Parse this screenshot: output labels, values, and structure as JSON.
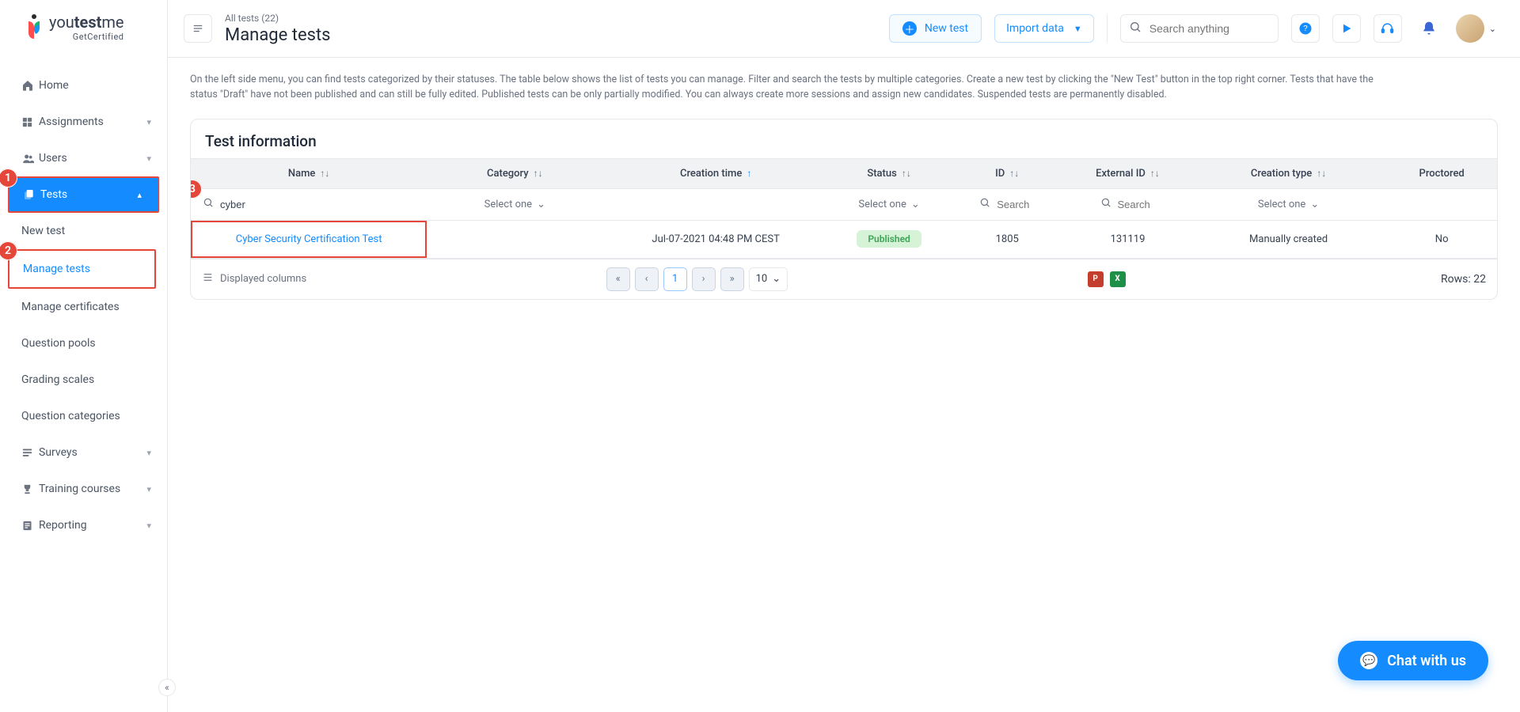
{
  "brand": {
    "you": "you",
    "test": "test",
    "me": "me",
    "sub": "GetCertified"
  },
  "sidebar": {
    "items": [
      {
        "label": "Home"
      },
      {
        "label": "Assignments"
      },
      {
        "label": "Users"
      },
      {
        "label": "Tests"
      },
      {
        "label": "Surveys"
      },
      {
        "label": "Training courses"
      },
      {
        "label": "Reporting"
      }
    ],
    "tests_sub": [
      {
        "label": "New test"
      },
      {
        "label": "Manage tests"
      },
      {
        "label": "Manage certificates"
      },
      {
        "label": "Question pools"
      },
      {
        "label": "Grading scales"
      },
      {
        "label": "Question categories"
      }
    ]
  },
  "header": {
    "breadcrumb": "All tests (22)",
    "title": "Manage tests",
    "new_btn": "New test",
    "import_btn": "Import data",
    "search_placeholder": "Search anything"
  },
  "intro": "On the left side menu, you can find tests categorized by their statuses. The table below shows the list of tests you can manage. Filter and search the tests by multiple categories. Create a new test by clicking the \"New Test\" button in the top right corner. Tests that have the status \"Draft\" have not been published and can still be fully edited. Published tests can be only partially modified. You can always create more sessions and assign new candidates. Suspended tests are permanently disabled.",
  "panel": {
    "title": "Test information",
    "columns": {
      "name": "Name",
      "category": "Category",
      "creation_time": "Creation time",
      "status": "Status",
      "id": "ID",
      "external_id": "External ID",
      "creation_type": "Creation type",
      "proctored": "Proctored"
    },
    "filters": {
      "name_value": "cyber",
      "select_one": "Select one",
      "search": "Search"
    },
    "rows": [
      {
        "name": "Cyber Security Certification Test",
        "category": "",
        "creation_time": "Jul-07-2021 04:48 PM CEST",
        "status": "Published",
        "id": "1805",
        "external_id": "131119",
        "creation_type": "Manually created",
        "proctored": "No"
      }
    ],
    "footer": {
      "displayed_columns": "Displayed columns",
      "page": "1",
      "page_size": "10",
      "rows_label": "Rows: 22"
    }
  },
  "chat": {
    "label": "Chat with us"
  },
  "annotations": {
    "a1": "1",
    "a2": "2",
    "a3": "3"
  }
}
